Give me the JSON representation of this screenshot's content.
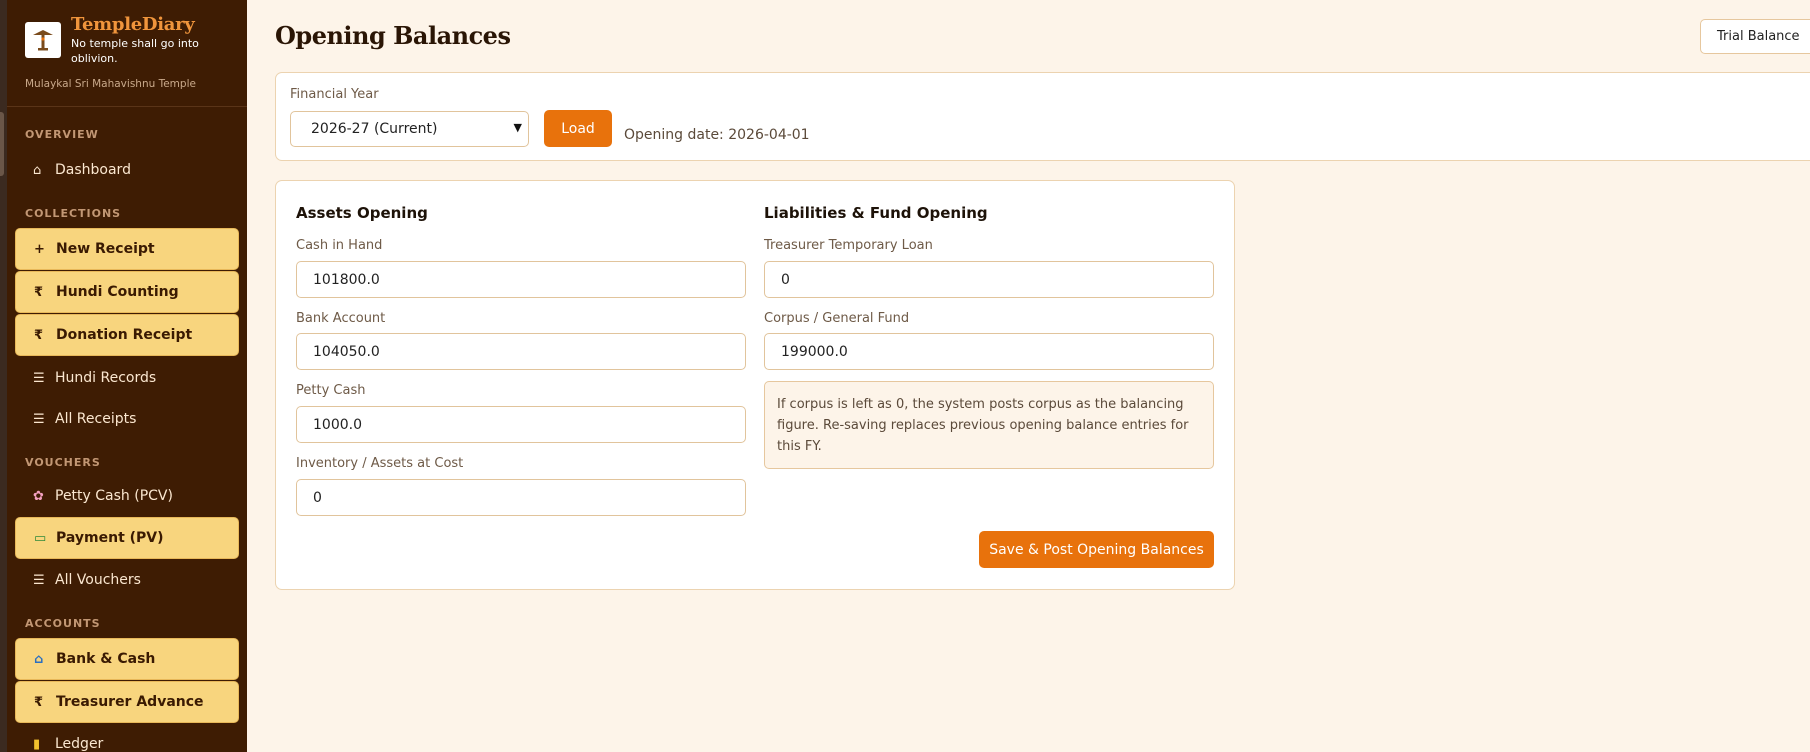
{
  "brand": {
    "name": "TempleDiary",
    "tagline": "No temple shall go into oblivion.",
    "temple": "Mulaykal Sri Mahavishnu Temple",
    "logo_icon": "temple-logo-icon"
  },
  "sidebar": {
    "sections": {
      "overview": "OVERVIEW",
      "collections": "COLLECTIONS",
      "vouchers": "VOUCHERS",
      "accounts": "ACCOUNTS"
    },
    "items": [
      {
        "label": "Dashboard",
        "icon": "⌂",
        "highlighted": false
      },
      {
        "label": "New Receipt",
        "icon": "+",
        "highlighted": true
      },
      {
        "label": "Hundi Counting",
        "icon": "₹",
        "highlighted": true
      },
      {
        "label": "Donation Receipt",
        "icon": "₹",
        "highlighted": true
      },
      {
        "label": "Hundi Records",
        "icon": "☰",
        "highlighted": false
      },
      {
        "label": "All Receipts",
        "icon": "☰",
        "highlighted": false
      },
      {
        "label": "Petty Cash (PCV)",
        "icon": "✿",
        "highlighted": false
      },
      {
        "label": "Payment (PV)",
        "icon": "▭",
        "highlighted": true
      },
      {
        "label": "All Vouchers",
        "icon": "☰",
        "highlighted": false
      },
      {
        "label": "Bank & Cash",
        "icon": "⌂",
        "highlighted": true
      },
      {
        "label": "Treasurer Advance",
        "icon": "₹",
        "highlighted": true
      },
      {
        "label": "Ledger",
        "icon": "▮",
        "highlighted": false
      }
    ]
  },
  "header": {
    "title": "Opening Balances",
    "trial_balance_label": "Trial Balance"
  },
  "fy": {
    "label": "Financial Year",
    "selected": "2026-27 (Current)",
    "load_label": "Load",
    "opening_date": "Opening date: 2026-04-01"
  },
  "assets": {
    "heading": "Assets Opening",
    "fields": [
      {
        "label": "Cash in Hand",
        "value": "101800.0"
      },
      {
        "label": "Bank Account",
        "value": "104050.0"
      },
      {
        "label": "Petty Cash",
        "value": "1000.0"
      },
      {
        "label": "Inventory / Assets at Cost",
        "value": "0"
      }
    ]
  },
  "liabilities": {
    "heading": "Liabilities & Fund Opening",
    "fields": [
      {
        "label": "Treasurer Temporary Loan",
        "value": "0"
      },
      {
        "label": "Corpus / General Fund",
        "value": "199000.0"
      }
    ],
    "note": "If corpus is left as 0, the system posts corpus as the balancing figure. Re-saving replaces previous opening balance entries for this FY."
  },
  "save_label": "Save & Post Opening Balances",
  "colors": {
    "sidebar_bg": "#3e1c03",
    "accent": "#e8720c",
    "highlight": "#f8d57e",
    "page_bg": "#fdf4e9"
  }
}
